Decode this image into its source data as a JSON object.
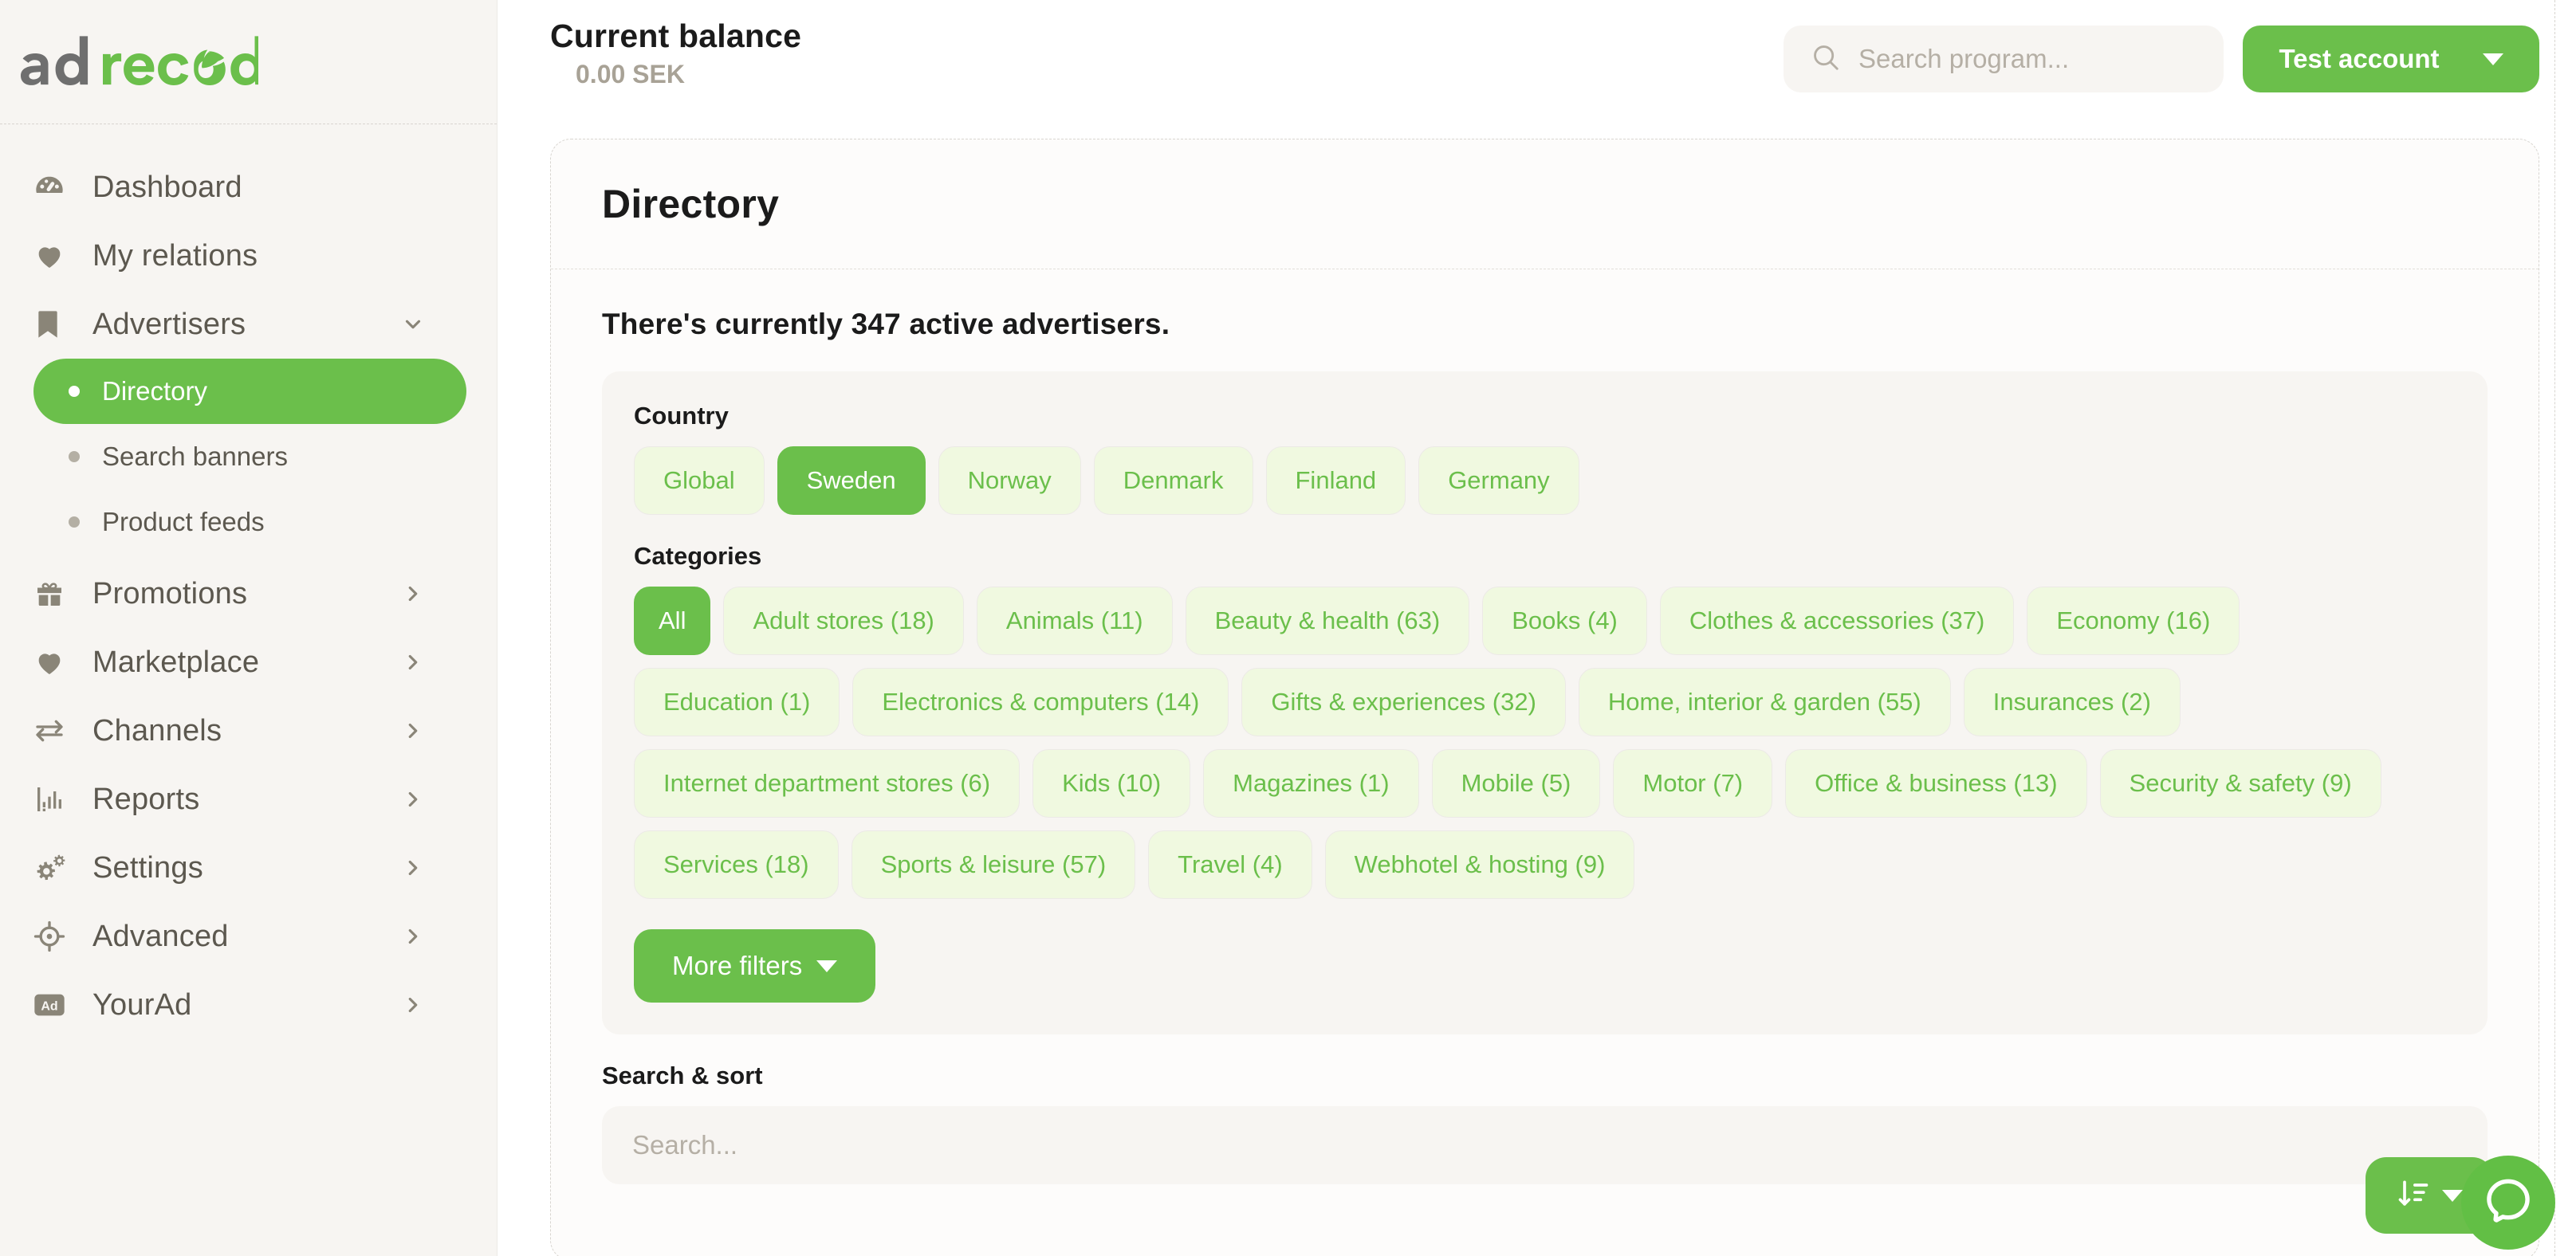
{
  "brand": {
    "logo_text_gray": "ad",
    "logo_text_green": "record",
    "accent": "#6bbf4b",
    "gray": "#6f6f6f",
    "chip_bg": "#f0f9e0",
    "sidebar_bg": "#f7f5f2"
  },
  "sidebar": {
    "items": [
      {
        "label": "Dashboard",
        "icon": "dashboard-gauge-icon",
        "has_chevron": false
      },
      {
        "label": "My relations",
        "icon": "heart-icon",
        "has_chevron": false
      },
      {
        "label": "Advertisers",
        "icon": "bookmark-icon",
        "has_chevron": true,
        "expanded": true
      },
      {
        "label": "Promotions",
        "icon": "gift-icon",
        "has_chevron": true
      },
      {
        "label": "Marketplace",
        "icon": "heart-icon",
        "has_chevron": true
      },
      {
        "label": "Channels",
        "icon": "exchange-arrows-icon",
        "has_chevron": true
      },
      {
        "label": "Reports",
        "icon": "bar-chart-icon",
        "has_chevron": true
      },
      {
        "label": "Settings",
        "icon": "gears-icon",
        "has_chevron": true
      },
      {
        "label": "Advanced",
        "icon": "crosshair-icon",
        "has_chevron": true
      },
      {
        "label": "YourAd",
        "icon": "ad-badge-icon",
        "has_chevron": true
      }
    ],
    "advertisers_subitems": [
      {
        "label": "Directory",
        "active": true
      },
      {
        "label": "Search banners",
        "active": false
      },
      {
        "label": "Product feeds",
        "active": false
      }
    ]
  },
  "topbar": {
    "balance_title": "Current balance",
    "balance_value": "0.00 SEK",
    "search_placeholder": "Search program...",
    "search_value": "",
    "search_icon": "search-icon",
    "account_label": "Test account",
    "account_caret": "chevron-down-icon"
  },
  "card": {
    "title": "Directory",
    "active_text": "There's currently 347 active advertisers.",
    "active_count": 347
  },
  "filters": {
    "country_label": "Country",
    "countries": [
      {
        "label": "Global",
        "selected": false
      },
      {
        "label": "Sweden",
        "selected": true
      },
      {
        "label": "Norway",
        "selected": false
      },
      {
        "label": "Denmark",
        "selected": false
      },
      {
        "label": "Finland",
        "selected": false
      },
      {
        "label": "Germany",
        "selected": false
      }
    ],
    "categories_label": "Categories",
    "categories": [
      {
        "label": "All",
        "selected": true
      },
      {
        "label": "Adult stores (18)",
        "selected": false
      },
      {
        "label": "Animals (11)",
        "selected": false
      },
      {
        "label": "Beauty & health (63)",
        "selected": false
      },
      {
        "label": "Books (4)",
        "selected": false
      },
      {
        "label": "Clothes & accessories (37)",
        "selected": false
      },
      {
        "label": "Economy (16)",
        "selected": false
      },
      {
        "label": "Education (1)",
        "selected": false
      },
      {
        "label": "Electronics & computers (14)",
        "selected": false
      },
      {
        "label": "Gifts & experiences (32)",
        "selected": false
      },
      {
        "label": "Home, interior & garden (55)",
        "selected": false
      },
      {
        "label": "Insurances (2)",
        "selected": false
      },
      {
        "label": "Internet department stores (6)",
        "selected": false
      },
      {
        "label": "Kids (10)",
        "selected": false
      },
      {
        "label": "Magazines (1)",
        "selected": false
      },
      {
        "label": "Mobile (5)",
        "selected": false
      },
      {
        "label": "Motor (7)",
        "selected": false
      },
      {
        "label": "Office & business (13)",
        "selected": false
      },
      {
        "label": "Security & safety (9)",
        "selected": false
      },
      {
        "label": "Services (18)",
        "selected": false
      },
      {
        "label": "Sports & leisure (57)",
        "selected": false
      },
      {
        "label": "Travel (4)",
        "selected": false
      },
      {
        "label": "Webhotel & hosting (9)",
        "selected": false
      }
    ],
    "more_filters_label": "More filters",
    "more_filters_caret": "chevron-down-icon"
  },
  "search_sort": {
    "label": "Search & sort",
    "search_placeholder": "Search...",
    "search_value": "",
    "sort_icon": "sort-descending-icon",
    "sort_caret": "chevron-down-icon"
  },
  "chat": {
    "icon": "chat-bubble-icon"
  }
}
